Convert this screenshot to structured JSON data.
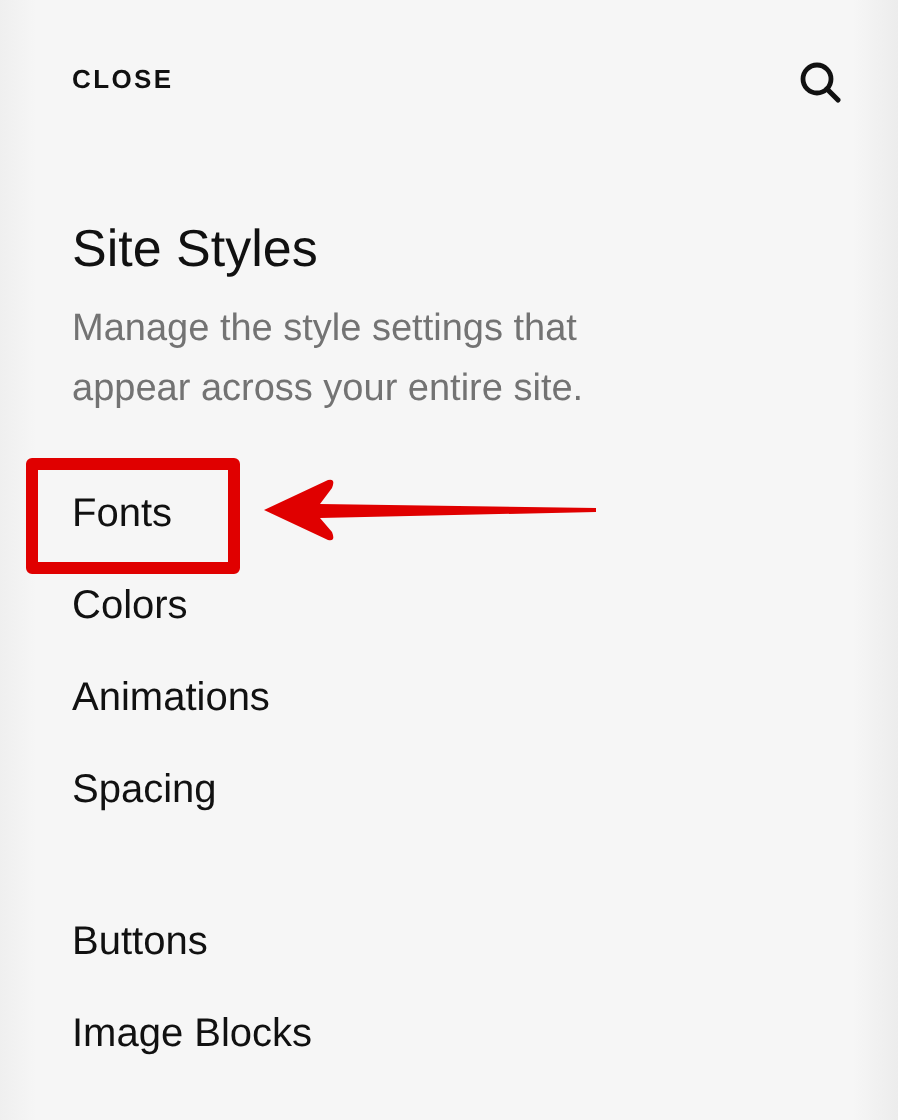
{
  "header": {
    "close": "CLOSE"
  },
  "title": "Site Styles",
  "description": "Manage the style settings that appear across your entire site.",
  "groups": [
    {
      "items": [
        {
          "label": "Fonts",
          "highlighted": true
        },
        {
          "label": "Colors",
          "highlighted": false
        },
        {
          "label": "Animations",
          "highlighted": false
        },
        {
          "label": "Spacing",
          "highlighted": false
        }
      ]
    },
    {
      "items": [
        {
          "label": "Buttons",
          "highlighted": false
        },
        {
          "label": "Image Blocks",
          "highlighted": false
        }
      ]
    }
  ]
}
